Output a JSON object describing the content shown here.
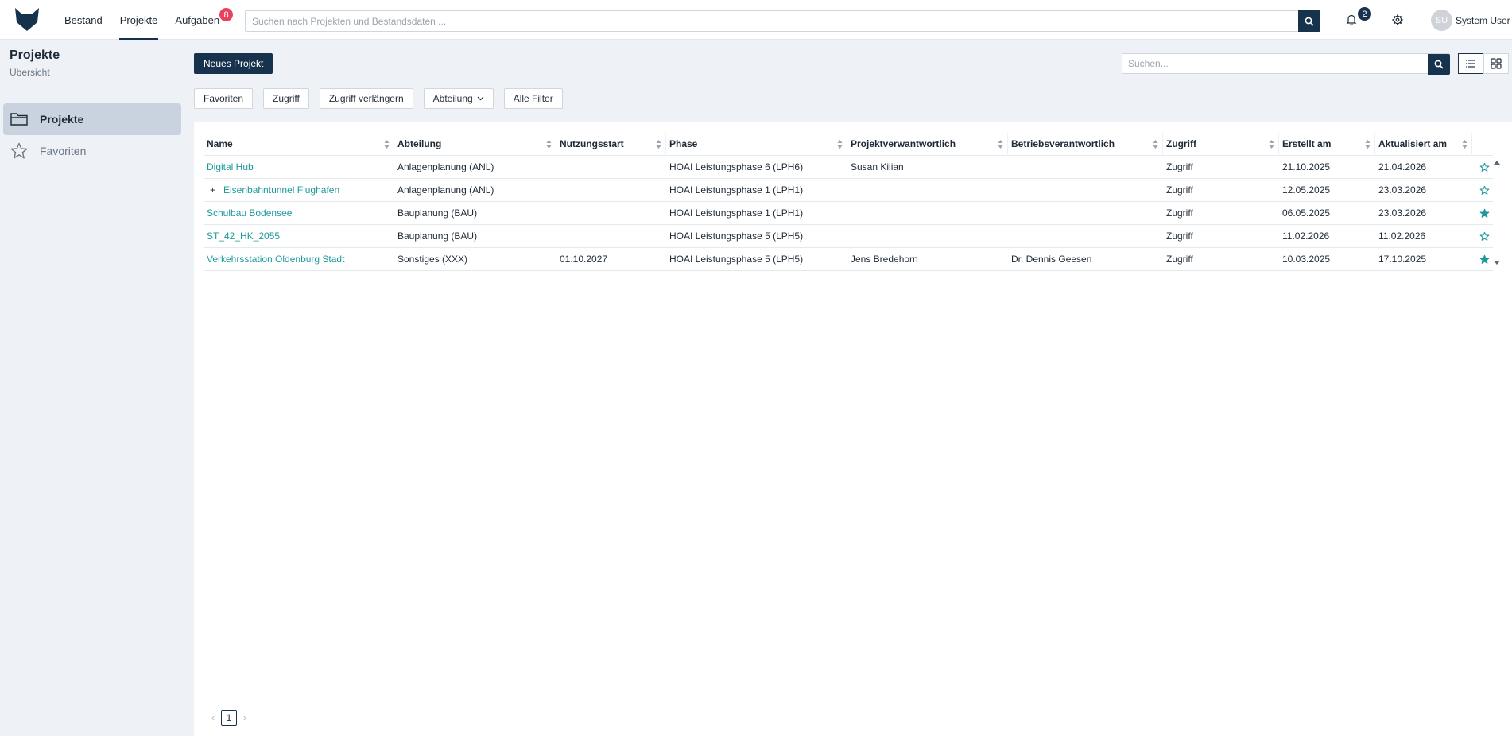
{
  "topbar": {
    "nav": [
      {
        "label": "Bestand",
        "active": false
      },
      {
        "label": "Projekte",
        "active": true
      },
      {
        "label": "Aufgaben",
        "active": false,
        "badge": "8"
      }
    ],
    "search_placeholder": "Suchen nach Projekten und Bestandsdaten ...",
    "notifications_count": "2",
    "user": {
      "initials": "SU",
      "name": "System User"
    }
  },
  "sidebar": {
    "title": "Projekte",
    "subtitle": "Übersicht",
    "items": [
      {
        "label": "Projekte",
        "icon": "folder-icon",
        "active": true
      },
      {
        "label": "Favoriten",
        "icon": "star-outline-icon",
        "active": false
      }
    ]
  },
  "toolbar": {
    "new_project_label": "Neues Projekt",
    "search_placeholder": "Suchen..."
  },
  "filters": [
    "Favoriten",
    "Zugriff",
    "Zugriff verlängern",
    "Abteilung",
    "Alle Filter"
  ],
  "table": {
    "columns": [
      "Name",
      "Abteilung",
      "Nutzungsstart",
      "Phase",
      "Projektverwantwortlich",
      "Betriebsverantwortlich",
      "Zugriff",
      "Erstellt am",
      "Aktualisiert am"
    ],
    "rows": [
      {
        "name": "Digital Hub",
        "expandable": false,
        "abteilung": "Anlagenplanung (ANL)",
        "nutzungsstart": "",
        "phase": "HOAI Leistungsphase 6 (LPH6)",
        "projektverantwortlich": "Susan Kilian",
        "betriebsverantwortlich": "",
        "zugriff": "Zugriff",
        "erstellt": "21.10.2025",
        "aktualisiert": "21.04.2026",
        "favorite": false
      },
      {
        "name": "Eisenbahntunnel Flughafen",
        "expandable": true,
        "abteilung": "Anlagenplanung (ANL)",
        "nutzungsstart": "",
        "phase": "HOAI Leistungsphase 1 (LPH1)",
        "projektverantwortlich": "",
        "betriebsverantwortlich": "",
        "zugriff": "Zugriff",
        "erstellt": "12.05.2025",
        "aktualisiert": "23.03.2026",
        "favorite": false
      },
      {
        "name": "Schulbau Bodensee",
        "expandable": false,
        "abteilung": "Bauplanung (BAU)",
        "nutzungsstart": "",
        "phase": "HOAI Leistungsphase 1 (LPH1)",
        "projektverantwortlich": "",
        "betriebsverantwortlich": "",
        "zugriff": "Zugriff",
        "erstellt": "06.05.2025",
        "aktualisiert": "23.03.2026",
        "favorite": true
      },
      {
        "name": "ST_42_HK_2055",
        "expandable": false,
        "abteilung": "Bauplanung (BAU)",
        "nutzungsstart": "",
        "phase": "HOAI Leistungsphase 5 (LPH5)",
        "projektverantwortlich": "",
        "betriebsverantwortlich": "",
        "zugriff": "Zugriff",
        "erstellt": "11.02.2026",
        "aktualisiert": "11.02.2026",
        "favorite": false
      },
      {
        "name": "Verkehrsstation Oldenburg Stadt",
        "expandable": false,
        "abteilung": "Sonstiges (XXX)",
        "nutzungsstart": "01.10.2027",
        "phase": "HOAI Leistungsphase 5 (LPH5)",
        "projektverantwortlich": "Jens Bredehorn",
        "betriebsverantwortlich": "Dr. Dennis Geesen",
        "zugriff": "Zugriff",
        "erstellt": "10.03.2025",
        "aktualisiert": "17.10.2025",
        "favorite": true
      }
    ]
  },
  "pagination": {
    "current_page": "1"
  },
  "colors": {
    "primary": "#17324d",
    "accent": "#1e9a9c",
    "badge": "#e8425e"
  }
}
